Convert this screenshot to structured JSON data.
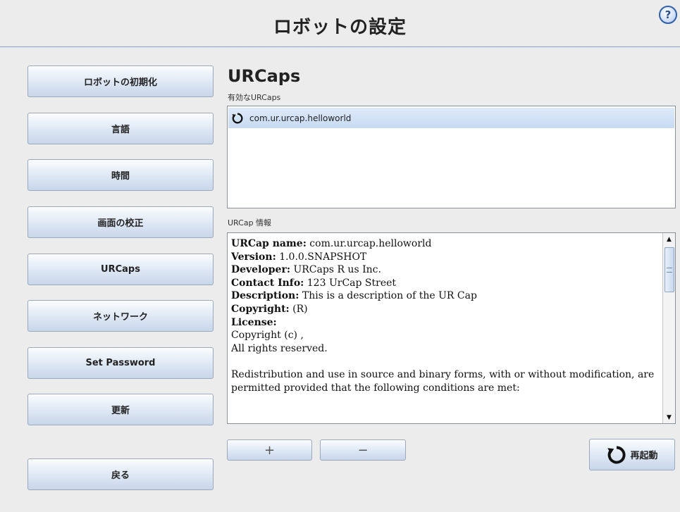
{
  "header": {
    "title": "ロボットの設定",
    "help_icon": "?"
  },
  "nav": {
    "items": [
      {
        "label": "ロボットの初期化"
      },
      {
        "label": "言語"
      },
      {
        "label": "時間"
      },
      {
        "label": "画面の校正"
      },
      {
        "label": "URCaps"
      },
      {
        "label": "ネットワーク"
      },
      {
        "label": "Set Password"
      },
      {
        "label": "更新"
      }
    ],
    "back_label": "戻る"
  },
  "main": {
    "title": "URCaps",
    "active_label": "有効なURCaps",
    "urcaps": [
      {
        "name": "com.ur.urcap.helloworld",
        "icon": "restart-icon"
      }
    ],
    "info_label": "URCap 情報",
    "info": {
      "name_label": "URCap name:",
      "name_value": " com.ur.urcap.helloworld",
      "version_label": "Version:",
      "version_value": " 1.0.0.SNAPSHOT",
      "developer_label": "Developer:",
      "developer_value": " URCaps R us Inc.",
      "contact_label": "Contact Info:",
      "contact_value": " 123 UrCap Street",
      "description_label": "Description:",
      "description_value": " This is a description of the UR Cap",
      "copyright_label": "Copyright:",
      "copyright_value": " (R)",
      "license_label": "License:",
      "license_line1": "Copyright (c) ,",
      "license_line2": "All rights reserved.",
      "license_para": "Redistribution and use in source and binary forms, with or without modification, are permitted provided that the following conditions are met:"
    },
    "add_label": "+",
    "remove_label": "−",
    "restart_label": "再起動"
  },
  "colors": {
    "accent": "#3060a8",
    "button_top": "#fbfdff",
    "button_bottom": "#c8d6ea",
    "selected": "#c8dbf3"
  }
}
